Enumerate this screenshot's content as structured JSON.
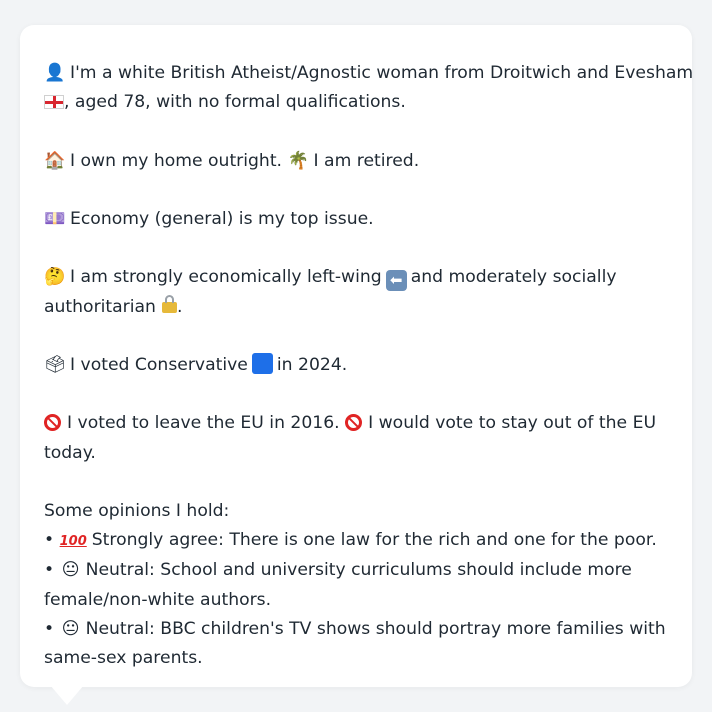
{
  "profile": {
    "line1": "I'm a white British Atheist/Agnostic woman from Droitwich and Evesham",
    "line2": ", aged 78, with no formal qualifications.",
    "home": "I own my home outright.",
    "retired": "I am retired.",
    "issue": "Economy (general) is my top issue.",
    "econ_part1": "I am strongly economically left-wing",
    "econ_part2": "and moderately socially",
    "econ_part3": "authoritarian",
    "vote_part1": "I voted Conservative",
    "vote_part2": "in 2024.",
    "eu_part1": "I voted to leave the EU in 2016.",
    "eu_part2": "I would vote to stay out of the EU",
    "eu_part3": "today.",
    "opinions_heading": "Some opinions I hold:",
    "opinion1": "Strongly agree: There is one law for the rich and one for the poor.",
    "opinion2a": "Neutral: School and university curriculums should include more",
    "opinion2b": "female/non-white authors.",
    "opinion3a": "Neutral: BBC children's TV shows should portray more families with",
    "opinion3b": "same-sex parents."
  },
  "icons": {
    "person": "👤",
    "house": "🏠",
    "palm": "🌴",
    "money": "💷",
    "thinking": "🤔",
    "ballot": "🗳",
    "neutral": "😐",
    "bullet": "•",
    "hundred": "100",
    "left_arrow": "⬅",
    "full_stop": "."
  },
  "colors": {
    "background": "#f2f4f6",
    "card": "#ffffff",
    "text": "#1f2933",
    "conservative": "#1e6fe8",
    "prohibited": "#e02424"
  }
}
